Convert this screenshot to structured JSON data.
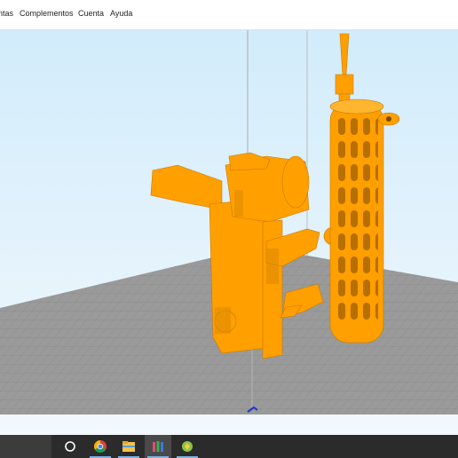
{
  "menubar": {
    "items": [
      {
        "label": "ntas"
      },
      {
        "label": "Complementos"
      },
      {
        "label": "Cuenta"
      },
      {
        "label": "Ayuda"
      }
    ]
  },
  "viewport": {
    "model_color": "#ff9f00",
    "build_plate_color": "#9a9a9a",
    "background_top": "#d2ecfb",
    "background_bottom": "#f2f8fd"
  },
  "taskbar": {
    "apps": [
      {
        "icon": "cortana-icon"
      },
      {
        "icon": "chrome-icon"
      },
      {
        "icon": "file-explorer-icon"
      },
      {
        "icon": "cura-app-icon"
      },
      {
        "icon": "app-icon"
      }
    ]
  }
}
